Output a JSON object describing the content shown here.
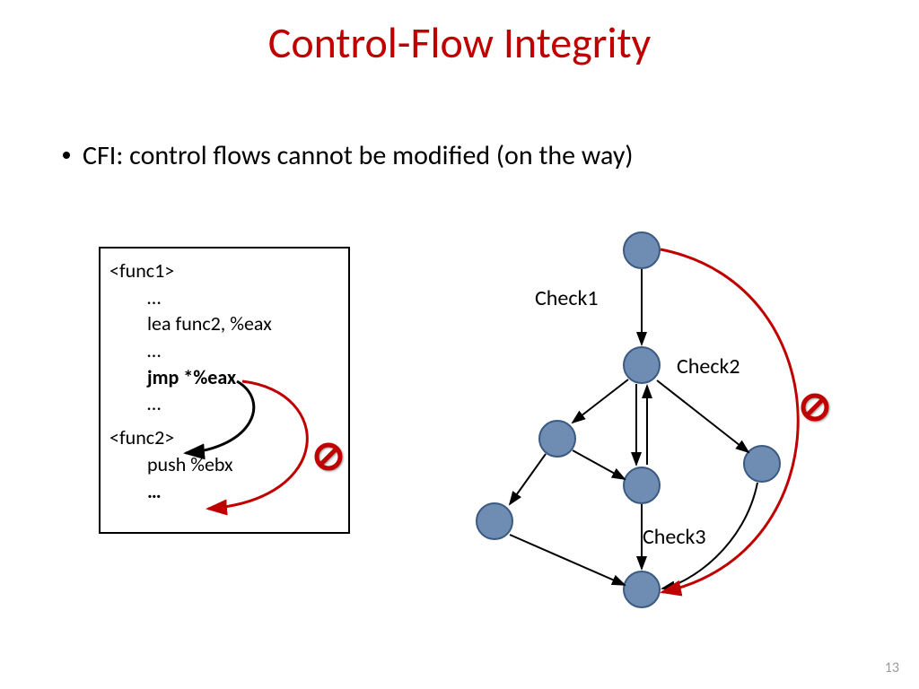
{
  "title": "Control-Flow Integrity",
  "bullet": "CFI: control flows cannot be modified (on the way)",
  "code": {
    "l1": "<func1>",
    "l2": "…",
    "l3": "lea func2, %eax",
    "l4": "…",
    "l5": "jmp *%eax",
    "l6": "…",
    "l7": "<func2>",
    "l8": "push %ebx",
    "l9": "…"
  },
  "graph_labels": {
    "c1": "Check1",
    "c2": "Check2",
    "c3": "Check3"
  },
  "page": "13"
}
